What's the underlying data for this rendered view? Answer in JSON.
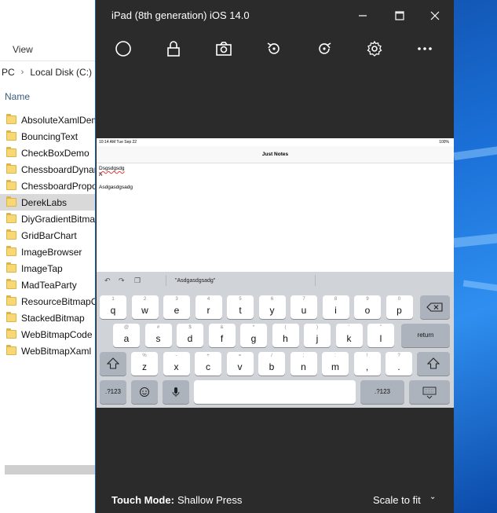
{
  "explorer": {
    "view_tab": "View",
    "address": {
      "pc": "PC",
      "disk": "Local Disk (C:)"
    },
    "column_header": "Name",
    "folders": [
      "AbsoluteXamlDemo",
      "BouncingText",
      "CheckBoxDemo",
      "ChessboardDynamic",
      "ChessboardProportional",
      "DerekLabs",
      "DiyGradientBitmap",
      "GridBarChart",
      "ImageBrowser",
      "ImageTap",
      "MadTeaParty",
      "ResourceBitmapCode",
      "StackedBitmap",
      "WebBitmapCode",
      "WebBitmapXaml"
    ],
    "selected_folder": "DerekLabs"
  },
  "simulator": {
    "title": "iPad (8th generation) iOS 14.0",
    "toolbar_icons": [
      "home-icon",
      "lock-icon",
      "screenshot-icon",
      "rotate-left-icon",
      "rotate-right-icon",
      "settings-icon",
      "more-icon"
    ],
    "ipad": {
      "status_time": "10:14 AM  Tue Sep 22",
      "status_battery": "100%",
      "nav_title": "Just Notes",
      "notes": [
        "Dsgsdgsdg",
        "A",
        "Asdgasdgsadg"
      ],
      "prediction": "\"Asdgasdgsadg\"",
      "keyboard": {
        "row1": [
          {
            "hint": "1",
            "key": "q"
          },
          {
            "hint": "2",
            "key": "w"
          },
          {
            "hint": "3",
            "key": "e"
          },
          {
            "hint": "4",
            "key": "r"
          },
          {
            "hint": "5",
            "key": "t"
          },
          {
            "hint": "6",
            "key": "y"
          },
          {
            "hint": "7",
            "key": "u"
          },
          {
            "hint": "8",
            "key": "i"
          },
          {
            "hint": "9",
            "key": "o"
          },
          {
            "hint": "0",
            "key": "p"
          }
        ],
        "row2": [
          {
            "hint": "@",
            "key": "a"
          },
          {
            "hint": "#",
            "key": "s"
          },
          {
            "hint": "$",
            "key": "d"
          },
          {
            "hint": "&",
            "key": "f"
          },
          {
            "hint": "*",
            "key": "g"
          },
          {
            "hint": "(",
            "key": "h"
          },
          {
            "hint": ")",
            "key": "j"
          },
          {
            "hint": "'",
            "key": "k"
          },
          {
            "hint": "\"",
            "key": "l"
          }
        ],
        "row3": [
          {
            "hint": "%",
            "key": "z"
          },
          {
            "hint": "-",
            "key": "x"
          },
          {
            "hint": "+",
            "key": "c"
          },
          {
            "hint": "=",
            "key": "v"
          },
          {
            "hint": "/",
            "key": "b"
          },
          {
            "hint": ";",
            "key": "n"
          },
          {
            "hint": ":",
            "key": "m"
          },
          {
            "hint": "!",
            "key": ","
          },
          {
            "hint": "?",
            "key": "."
          }
        ],
        "return_label": "return",
        "numbers_label": ".?123"
      }
    },
    "bottom_bar": {
      "touch_mode_label": "Touch Mode:",
      "touch_mode_value": "Shallow Press",
      "scale_label": "Scale to fit"
    }
  }
}
